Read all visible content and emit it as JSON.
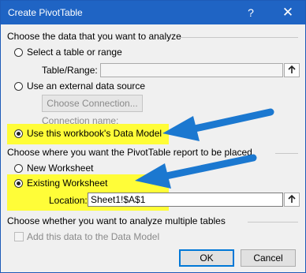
{
  "window": {
    "title": "Create PivotTable",
    "help_glyph": "?",
    "close_glyph": "✕"
  },
  "section_data": {
    "heading": "Choose the data that you want to analyze",
    "opt_table": "Select a table or range",
    "table_range_label": "Table/Range:",
    "opt_external": "Use an external data source",
    "choose_connection": "Choose Connection...",
    "connection_name_label": "Connection name:",
    "opt_data_model": "Use this workbook's Data Model"
  },
  "section_place": {
    "heading": "Choose where you want the PivotTable report to be placed",
    "opt_new": "New Worksheet",
    "opt_existing": "Existing Worksheet",
    "location_label": "Location:",
    "location_value": "Sheet1!$A$1"
  },
  "section_multi": {
    "heading": "Choose whether you want to analyze multiple tables",
    "add_to_model": "Add this data to the Data Model"
  },
  "buttons": {
    "ok": "OK",
    "cancel": "Cancel"
  },
  "colors": {
    "titlebar": "#1f64c4",
    "highlight": "#fffd38",
    "arrow": "#1b78d0"
  }
}
